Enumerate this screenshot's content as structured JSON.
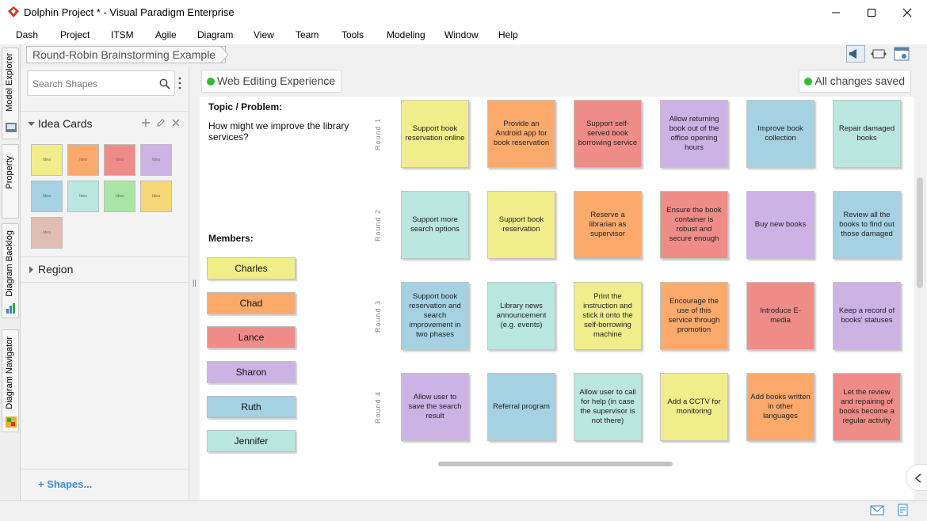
{
  "window": {
    "title": "Dolphin Project * - Visual Paradigm Enterprise"
  },
  "menu": [
    "Dash",
    "Project",
    "ITSM",
    "Agile",
    "Diagram",
    "View",
    "Team",
    "Tools",
    "Modeling",
    "Window",
    "Help"
  ],
  "side_tabs": [
    "Model Explorer",
    "Property",
    "Diagram Backlog",
    "Diagram Navigator"
  ],
  "breadcrumb": "Round-Robin Brainstorming Example",
  "shapes_panel": {
    "search_placeholder": "Search Shapes",
    "section_idea_cards": "Idea Cards",
    "swatch_label": "Idea",
    "swatch_colors": [
      "#f0ed8a",
      "#fcaa6c",
      "#f08c88",
      "#cdb2e6",
      "#a4d2e3",
      "#b9e6de",
      "#a9e6a6",
      "#f5d875",
      "#e1bcb2"
    ],
    "section_region": "Region",
    "shapes_link": "Shapes..."
  },
  "canvas_header": {
    "editing_label": "Web Editing Experience",
    "saved_label": "All changes saved",
    "status_color": "#2cc12c"
  },
  "topic": {
    "label": "Topic / Problem:",
    "text": "How might we improve the library services?"
  },
  "members": {
    "label": "Members:",
    "list": [
      {
        "name": "Charles",
        "color": "#f0ed8a"
      },
      {
        "name": "Chad",
        "color": "#fcaa6c"
      },
      {
        "name": "Lance",
        "color": "#f08c88"
      },
      {
        "name": "Sharon",
        "color": "#cdb2e6"
      },
      {
        "name": "Ruth",
        "color": "#a4d2e3"
      },
      {
        "name": "Jennifer",
        "color": "#b9e6de"
      }
    ]
  },
  "rounds": [
    {
      "label": "Round 1",
      "cards": [
        {
          "text": "Support book reservation online",
          "color": "#f0ed8a"
        },
        {
          "text": "Provide an Android app for book reservation",
          "color": "#fcaa6c"
        },
        {
          "text": "Support self-served book borrowing service",
          "color": "#f08c88"
        },
        {
          "text": "Allow returning book out of the office opening hours",
          "color": "#cdb2e6"
        },
        {
          "text": "Improve book collection",
          "color": "#a4d2e3"
        },
        {
          "text": "Repair damaged books",
          "color": "#b9e6de"
        }
      ]
    },
    {
      "label": "Round 2",
      "cards": [
        {
          "text": "Support more search options",
          "color": "#b9e6de"
        },
        {
          "text": "Support book reservation",
          "color": "#f0ed8a"
        },
        {
          "text": "Reserve a librarian as supervisor",
          "color": "#fcaa6c"
        },
        {
          "text": "Ensure the book container is robust and secure enough",
          "color": "#f08c88"
        },
        {
          "text": "Buy new books",
          "color": "#cdb2e6"
        },
        {
          "text": "Review all the books to find out those damaged",
          "color": "#a4d2e3"
        }
      ]
    },
    {
      "label": "Round 3",
      "cards": [
        {
          "text": "Support book reservation and search improvement in two phases",
          "color": "#a4d2e3"
        },
        {
          "text": "Library news announcement (e.g. events)",
          "color": "#b9e6de"
        },
        {
          "text": "Print the instruction and stick it onto the self-borrowing machine",
          "color": "#f0ed8a"
        },
        {
          "text": "Encourage the use of this service through promotion",
          "color": "#fcaa6c"
        },
        {
          "text": "Introduce E-media",
          "color": "#f08c88"
        },
        {
          "text": "Keep a record of books' statuses",
          "color": "#cdb2e6"
        }
      ]
    },
    {
      "label": "Round 4",
      "cards": [
        {
          "text": "Allow user to save the search result",
          "color": "#cdb2e6"
        },
        {
          "text": "Referral program",
          "color": "#a4d2e3"
        },
        {
          "text": "Allow user to call for help (in case the supervisor is not there)",
          "color": "#b9e6de"
        },
        {
          "text": "Add a CCTV for monitoring",
          "color": "#f0ed8a"
        },
        {
          "text": "Add books written in other languages",
          "color": "#fcaa6c"
        },
        {
          "text": "Let the review and repairing of books become a regular activity",
          "color": "#f08c88"
        }
      ]
    }
  ]
}
